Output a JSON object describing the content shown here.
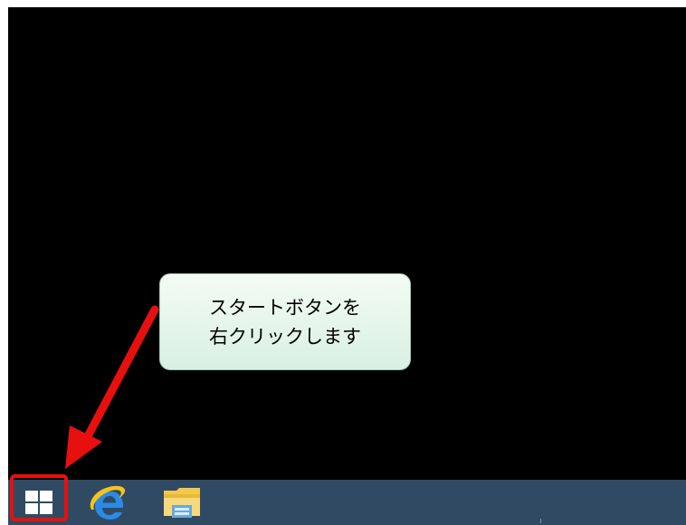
{
  "callout": {
    "line1": "スタートボタンを",
    "line2": "右クリックします"
  },
  "taskbar": {
    "items": [
      {
        "name": "start-button",
        "icon": "windows-logo-icon"
      },
      {
        "name": "internet-explorer-button",
        "icon": "internet-explorer-icon"
      },
      {
        "name": "file-explorer-button",
        "icon": "file-explorer-icon"
      }
    ]
  },
  "colors": {
    "desktop": "#000000",
    "taskbar": "#304a63",
    "highlight": "#e8100e",
    "callout_fill": "#e3f4ea"
  }
}
